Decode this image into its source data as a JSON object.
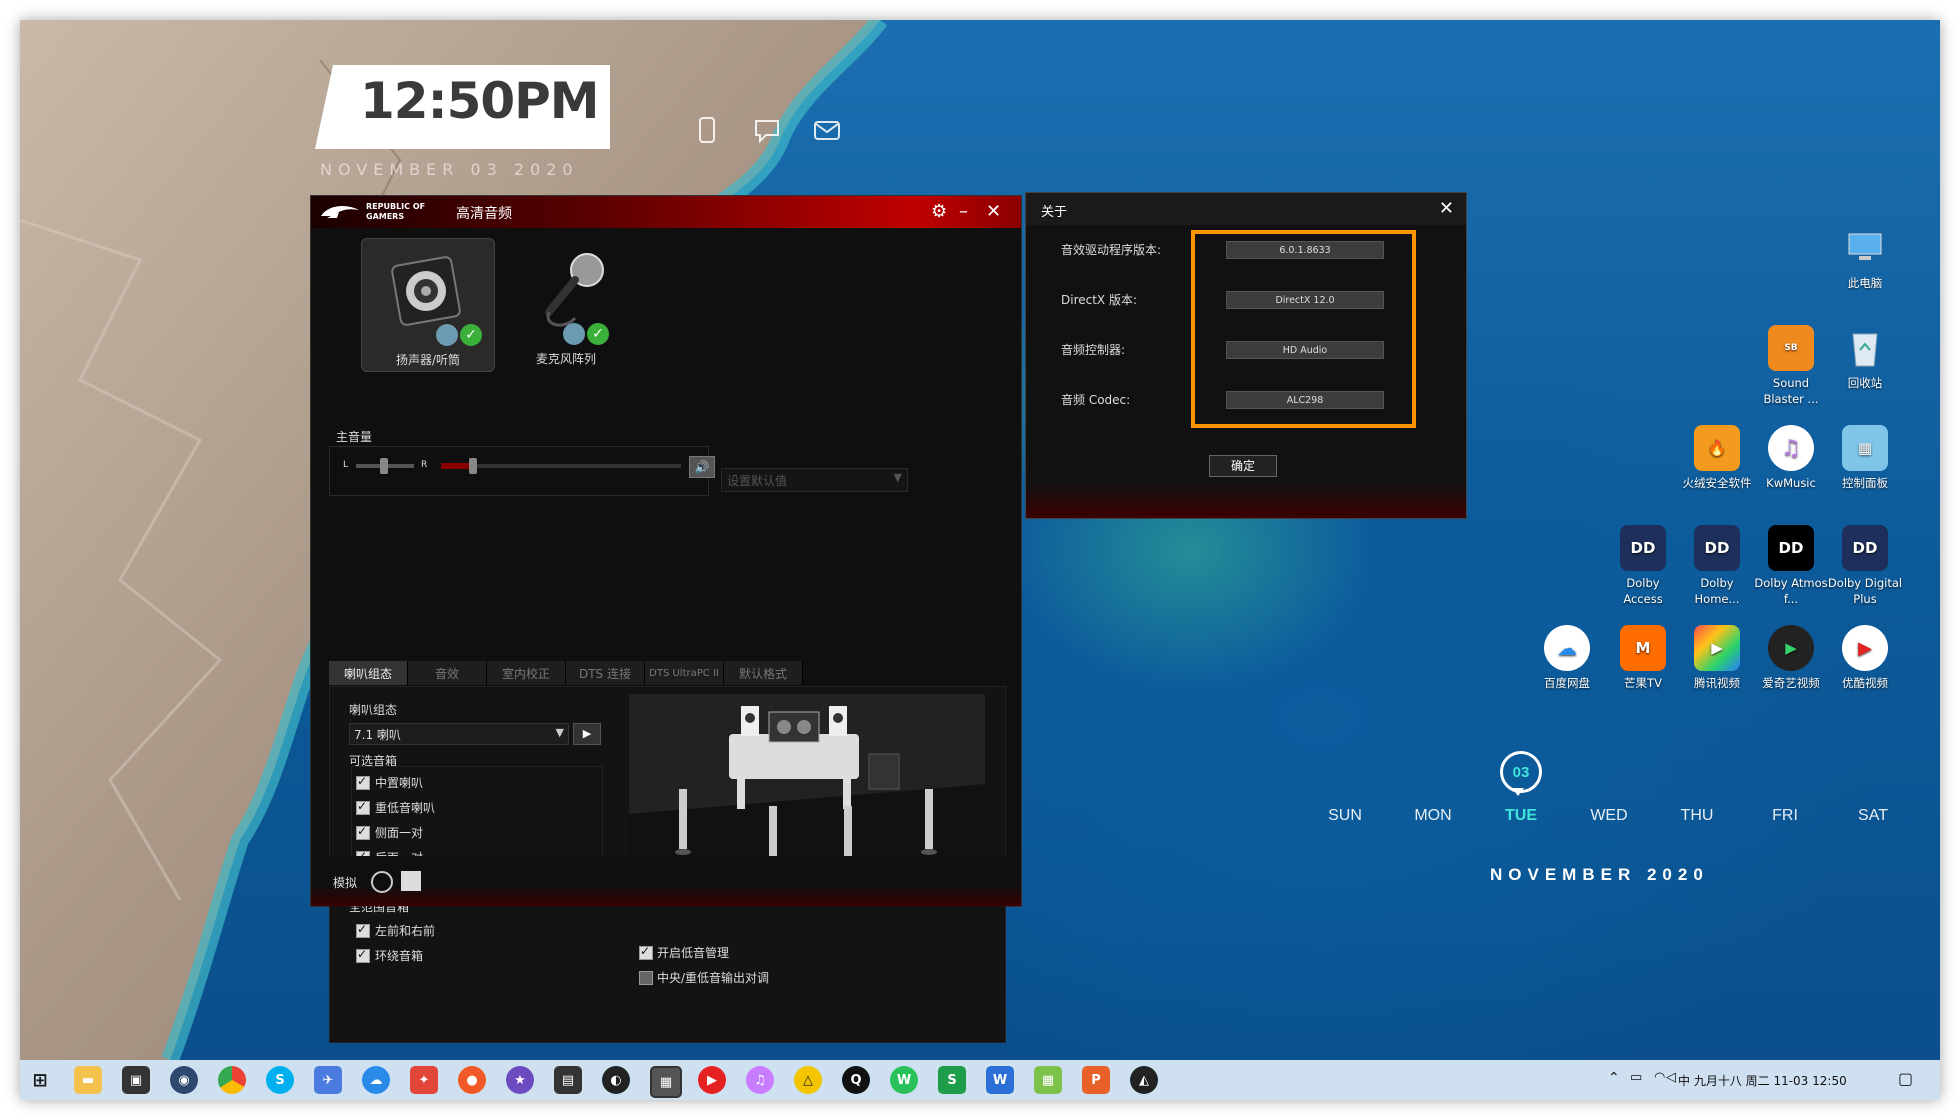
{
  "clock": {
    "time": "12:50PM",
    "date": "NOVEMBER 03 2020"
  },
  "rog_window": {
    "brand": "REPUBLIC OF GAMERS",
    "title": "高清音频",
    "devices": [
      {
        "label": "扬声器/听筒"
      },
      {
        "label": "麦克风阵列"
      }
    ],
    "master_volume_label": "主音量",
    "balance_left": "L",
    "balance_right": "R",
    "set_default_placeholder": "设置默认值",
    "tabs": [
      "喇叭组态",
      "音效",
      "室内校正",
      "DTS 连接",
      "DTS UltraPC II",
      "默认格式"
    ],
    "config_label": "喇叭组态",
    "config_select": "7.1 喇叭",
    "optional_label": "可选音箱",
    "optional_items": [
      {
        "label": "中置喇叭",
        "checked": true
      },
      {
        "label": "重低音喇叭",
        "checked": true
      },
      {
        "label": "侧面一对",
        "checked": true
      },
      {
        "label": "后面一对",
        "checked": true
      }
    ],
    "fullrange_label": "全范围音箱",
    "fullrange_items": [
      {
        "label": "左前和右前",
        "checked": true
      },
      {
        "label": "环绕音箱",
        "checked": true
      }
    ],
    "bass_items": [
      {
        "label": "开启低音管理",
        "checked": true
      },
      {
        "label": "中央/重低音输出对调",
        "checked": false
      }
    ],
    "analog_label": "模拟"
  },
  "about_dialog": {
    "title": "关于",
    "rows": [
      {
        "label": "音效驱动程序版本:",
        "value": "6.0.1.8633"
      },
      {
        "label": "DirectX 版本:",
        "value": "DirectX 12.0"
      },
      {
        "label": "音频控制器:",
        "value": "HD Audio"
      },
      {
        "label": "音频 Codec:",
        "value": "ALC298"
      }
    ],
    "ok_label": "确定",
    "highlight_color": "#ff9500"
  },
  "desktop_icons": [
    {
      "label": "此电脑",
      "icon": "computer-icon"
    },
    {
      "label": "Sound Blaster ...",
      "icon": "sound-blaster-icon"
    },
    {
      "label": "回收站",
      "icon": "recycle-bin-icon"
    },
    {
      "label": "火绒安全软件",
      "icon": "huorong-icon"
    },
    {
      "label": "KwMusic",
      "icon": "kwmusic-icon"
    },
    {
      "label": "控制面板",
      "icon": "control-panel-icon"
    },
    {
      "label": "Dolby Access",
      "icon": "dolby-icon"
    },
    {
      "label": "Dolby Home...",
      "icon": "dolby-icon"
    },
    {
      "label": "Dolby Atmos f...",
      "icon": "dolby-icon"
    },
    {
      "label": "Dolby Digital Plus",
      "icon": "dolby-icon"
    },
    {
      "label": "百度网盘",
      "icon": "baidu-netdisk-icon"
    },
    {
      "label": "芒果TV",
      "icon": "mango-tv-icon"
    },
    {
      "label": "腾讯视频",
      "icon": "tencent-video-icon"
    },
    {
      "label": "爱奇艺视频",
      "icon": "iqiyi-icon"
    },
    {
      "label": "优酷视频",
      "icon": "youku-icon"
    }
  ],
  "calendar": {
    "today_number": "03",
    "days": [
      "SUN",
      "MON",
      "TUE",
      "WED",
      "THU",
      "FRI",
      "SAT"
    ],
    "today_index": 2,
    "month": "NOVEMBER 2020",
    "today_color": "#3ee6d8"
  },
  "taskbar": {
    "apps": [
      "start-icon",
      "file-explorer-icon",
      "store-icon",
      "app-icon",
      "chrome-icon",
      "skype-icon",
      "feather-icon",
      "cloud-icon",
      "app-icon",
      "app-icon",
      "app-icon",
      "app-icon",
      "app-icon",
      "app-icon",
      "youtube-icon",
      "music-icon",
      "app-icon",
      "qq-icon",
      "wechat-icon",
      "excel-icon",
      "word-icon",
      "app-icon",
      "powerpoint-icon",
      "app-icon"
    ],
    "tray_text": "中  九月十八 周二 11-03 12:50"
  }
}
